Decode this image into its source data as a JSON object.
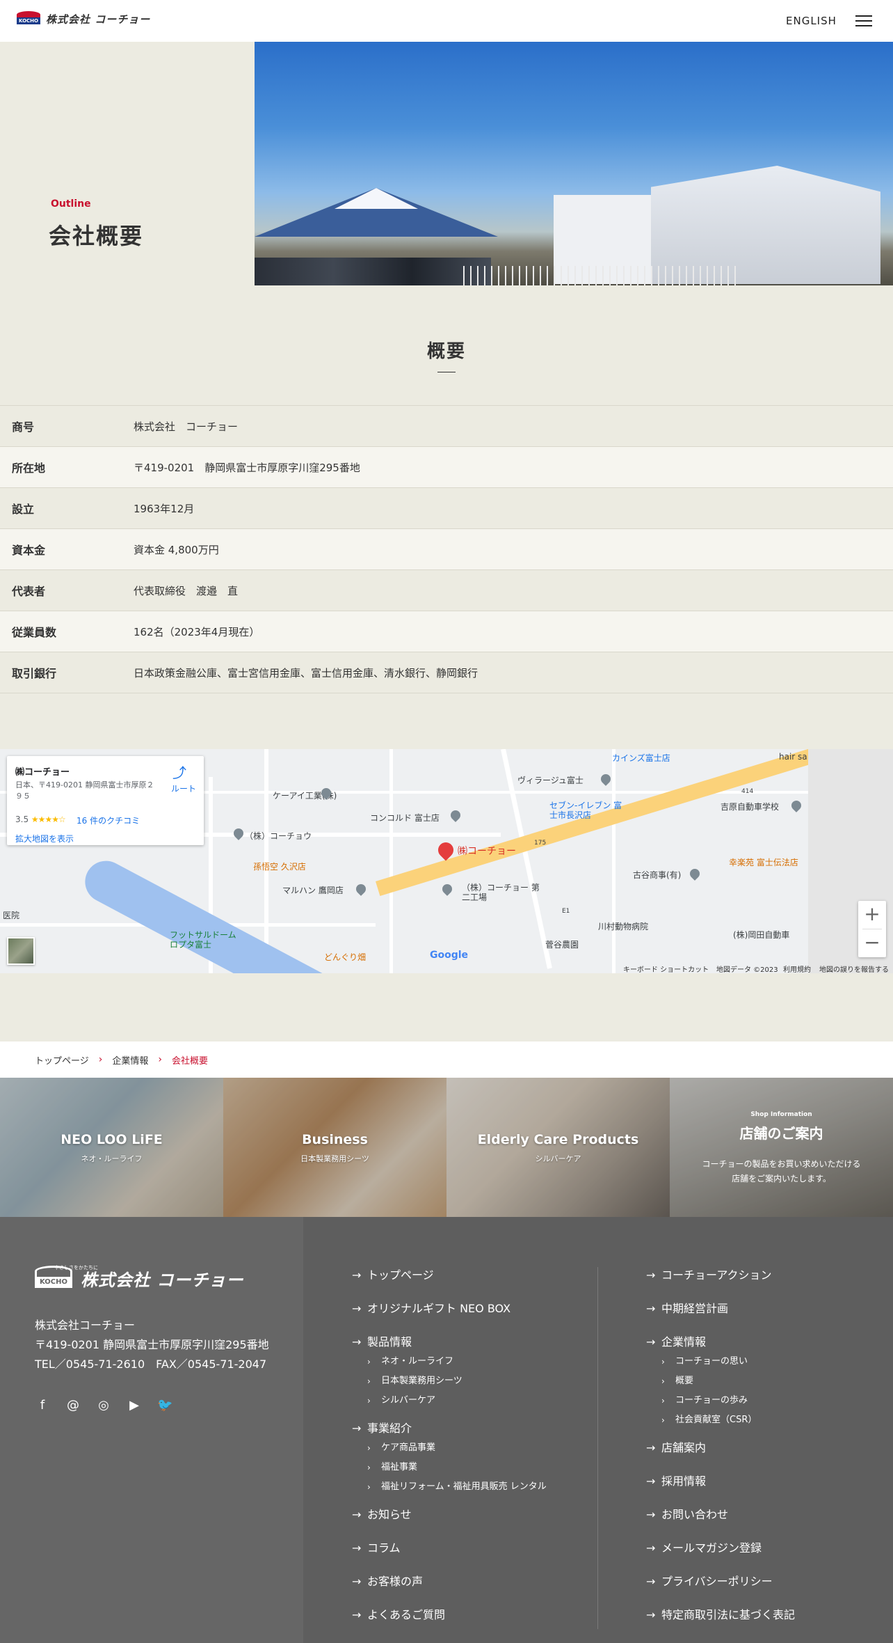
{
  "header": {
    "logo_badge": "KOCHO",
    "logo_text": "株式会社 コーチョー",
    "lang_link": "ENGLISH",
    "menu_icon": "hamburger-icon"
  },
  "hero": {
    "eyebrow": "Outline",
    "title": "会社概要"
  },
  "overview": {
    "heading": "概要",
    "rows": [
      {
        "label": "商号",
        "value": "株式会社　コーチョー"
      },
      {
        "label": "所在地",
        "value": "〒419-0201　静岡県富士市厚原字川窪295番地"
      },
      {
        "label": "設立",
        "value": "1963年12月"
      },
      {
        "label": "資本金",
        "value": "資本金 4,800万円"
      },
      {
        "label": "代表者",
        "value": "代表取締役　渡邉　直"
      },
      {
        "label": "従業員数",
        "value": "162名（2023年4月現在）"
      },
      {
        "label": "取引銀行",
        "value": "日本政策金融公庫、富士宮信用金庫、富士信用金庫、清水銀行、静岡銀行"
      }
    ]
  },
  "map": {
    "card": {
      "name": "㈱コーチョー",
      "address": "日本、〒419-0201 静岡県富士市厚原２９５",
      "rating": "3.5",
      "stars": "★★★★☆",
      "reviews": "16 件のクチコミ",
      "larger_map": "拡大地図を表示",
      "route": "ルート"
    },
    "labels": {
      "kainzu": "カインズ富士店",
      "villaggio": "ヴィラージュ富士",
      "seven": "セブン-イレブン 富士市長沢店",
      "yoshihara": "吉原自動車学校",
      "kei_ai": "ケーアイ工業(株)",
      "concorde": "コンコルド 富士店",
      "kocho_main": "㈱コーチョー",
      "kocho_small": "（株）コーチョウ",
      "goku": "孫悟空 久沢店",
      "maruhan": "マルハン 鷹岡店",
      "kocho_2": "（株）コーチョー 第二工場",
      "furuya": "古谷商事(有)",
      "kourakuen": "幸楽苑 富士伝法店",
      "kawamura": "川村動物病院",
      "kubota": "(株)岡田自動車",
      "sugaya": "菅谷農園",
      "futsal": "フットサルドーム ロプタ富士",
      "donguri": "どんぐり畑",
      "hairsa": "hair sa",
      "hospital": "医院",
      "route_414": "414",
      "route_175": "175",
      "route_e1": "E1"
    },
    "google": "Google",
    "footer": {
      "shortcuts": "キーボード ショートカット",
      "data": "地図データ ©2023",
      "terms": "利用規約",
      "report": "地図の誤りを報告する"
    },
    "zoom_in": "+",
    "zoom_out": "−"
  },
  "breadcrumb": {
    "items": [
      "トップページ",
      "企業情報",
      "会社概要"
    ],
    "separator": "›"
  },
  "tiles": [
    {
      "title": "NEO LOO LiFE",
      "sub": "ネオ・ルーライフ"
    },
    {
      "title": "Business",
      "sub": "日本製業務用シーツ"
    },
    {
      "title": "Elderly Care Products",
      "sub": "シルバーケア"
    },
    {
      "small": "Shop Information",
      "title": "店舗のご案内",
      "desc1": "コーチョーの製品をお買い求めいただける",
      "desc2": "店舗をご案内いたします。"
    }
  ],
  "footer": {
    "logo_badge": "KOCHO",
    "logo_text": "株式会社 コーチョー",
    "tagline": "やさしさをかたちに",
    "company": "株式会社コーチョー",
    "address": "〒419-0201 静岡県富士市厚原字川窪295番地",
    "contact": "TEL／0545-71-2610　FAX／0545-71-2047",
    "social": [
      "facebook-icon",
      "at-icon",
      "instagram-icon",
      "youtube-icon",
      "twitter-icon"
    ],
    "col1": {
      "top": "トップページ",
      "gift": "オリジナルギフト NEO BOX",
      "products": "製品情報",
      "products_sub": [
        "ネオ・ルーライフ",
        "日本製業務用シーツ",
        "シルバーケア"
      ],
      "business": "事業紹介",
      "business_sub": [
        "ケア商品事業",
        "福祉事業",
        "福祉リフォーム・福祉用具販売 レンタル"
      ],
      "news": "お知らせ",
      "column": "コラム",
      "voice": "お客様の声",
      "faq": "よくあるご質問"
    },
    "col2": {
      "action": "コーチョーアクション",
      "plan": "中期経営計画",
      "corporate": "企業情報",
      "corporate_sub": [
        "コーチョーの思い",
        "概要",
        "コーチョーの歩み",
        "社会貢献室（CSR）"
      ],
      "shops": "店舗案内",
      "recruit": "採用情報",
      "contact": "お問い合わせ",
      "magazine": "メールマガジン登録",
      "privacy": "プライバシーポリシー",
      "tokusho": "特定商取引法に基づく表記"
    }
  }
}
